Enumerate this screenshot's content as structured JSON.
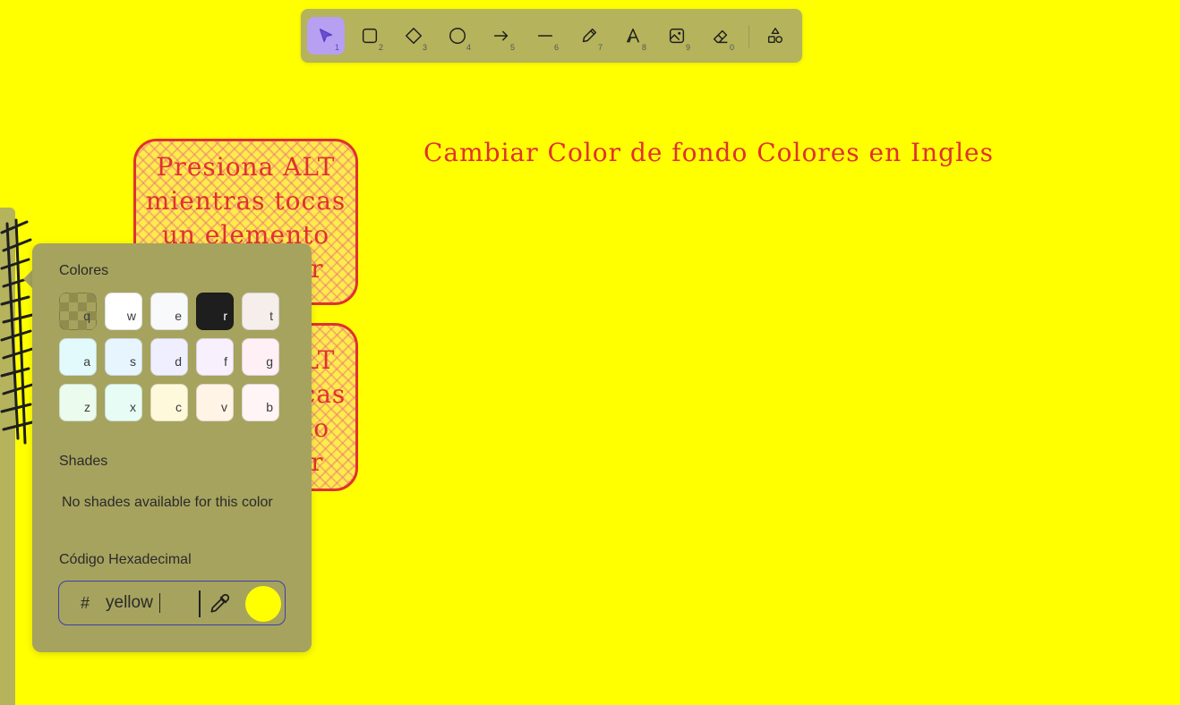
{
  "toolbar": {
    "tools": [
      {
        "name": "selection",
        "key": "1",
        "active": true,
        "icon": "cursor-icon"
      },
      {
        "name": "rectangle",
        "key": "2",
        "icon": "rectangle-icon"
      },
      {
        "name": "diamond",
        "key": "3",
        "icon": "diamond-icon"
      },
      {
        "name": "ellipse",
        "key": "4",
        "icon": "ellipse-icon"
      },
      {
        "name": "arrow",
        "key": "5",
        "icon": "arrow-icon"
      },
      {
        "name": "line",
        "key": "6",
        "icon": "line-icon"
      },
      {
        "name": "draw",
        "key": "7",
        "icon": "pencil-icon"
      },
      {
        "name": "text",
        "key": "8",
        "icon": "text-icon"
      },
      {
        "name": "image",
        "key": "9",
        "icon": "image-icon"
      },
      {
        "name": "eraser",
        "key": "0",
        "icon": "eraser-icon"
      },
      {
        "name": "more-shapes",
        "key": "",
        "icon": "shapes-icon"
      }
    ]
  },
  "canvas": {
    "title_text": "Cambiar Color de fondo Colores en Ingles",
    "card1_lines": [
      "Presiona ALT",
      "mientras tocas",
      "un elemento",
      "para copiar"
    ],
    "card2_lines": [
      "Presiona ALT",
      "mientras tocas",
      "un elemento",
      "para copiar"
    ],
    "background_color": "#ffff00",
    "text_color": "#e03131"
  },
  "color_picker": {
    "colors_label": "Colores",
    "swatches": [
      {
        "key": "q",
        "color": "transparent"
      },
      {
        "key": "w",
        "color": "#ffffff"
      },
      {
        "key": "e",
        "color": "#f8f9fa"
      },
      {
        "key": "r",
        "color": "#1e1e1e"
      },
      {
        "key": "t",
        "color": "#f5eeeb"
      },
      {
        "key": "a",
        "color": "#e3fafc"
      },
      {
        "key": "s",
        "color": "#e7f5ff"
      },
      {
        "key": "d",
        "color": "#f0efff"
      },
      {
        "key": "f",
        "color": "#f8f0fc"
      },
      {
        "key": "g",
        "color": "#fff0f6"
      },
      {
        "key": "z",
        "color": "#ebfbee"
      },
      {
        "key": "x",
        "color": "#e6fcf5"
      },
      {
        "key": "c",
        "color": "#fff9db"
      },
      {
        "key": "v",
        "color": "#fff4e6"
      },
      {
        "key": "b",
        "color": "#fff5f5"
      }
    ],
    "shades_label": "Shades",
    "shades_empty": "No shades available for this color",
    "hex_label": "Código Hexadecimal",
    "hash": "#",
    "hex_value": "yellow",
    "preview_color": "#ffff00"
  }
}
